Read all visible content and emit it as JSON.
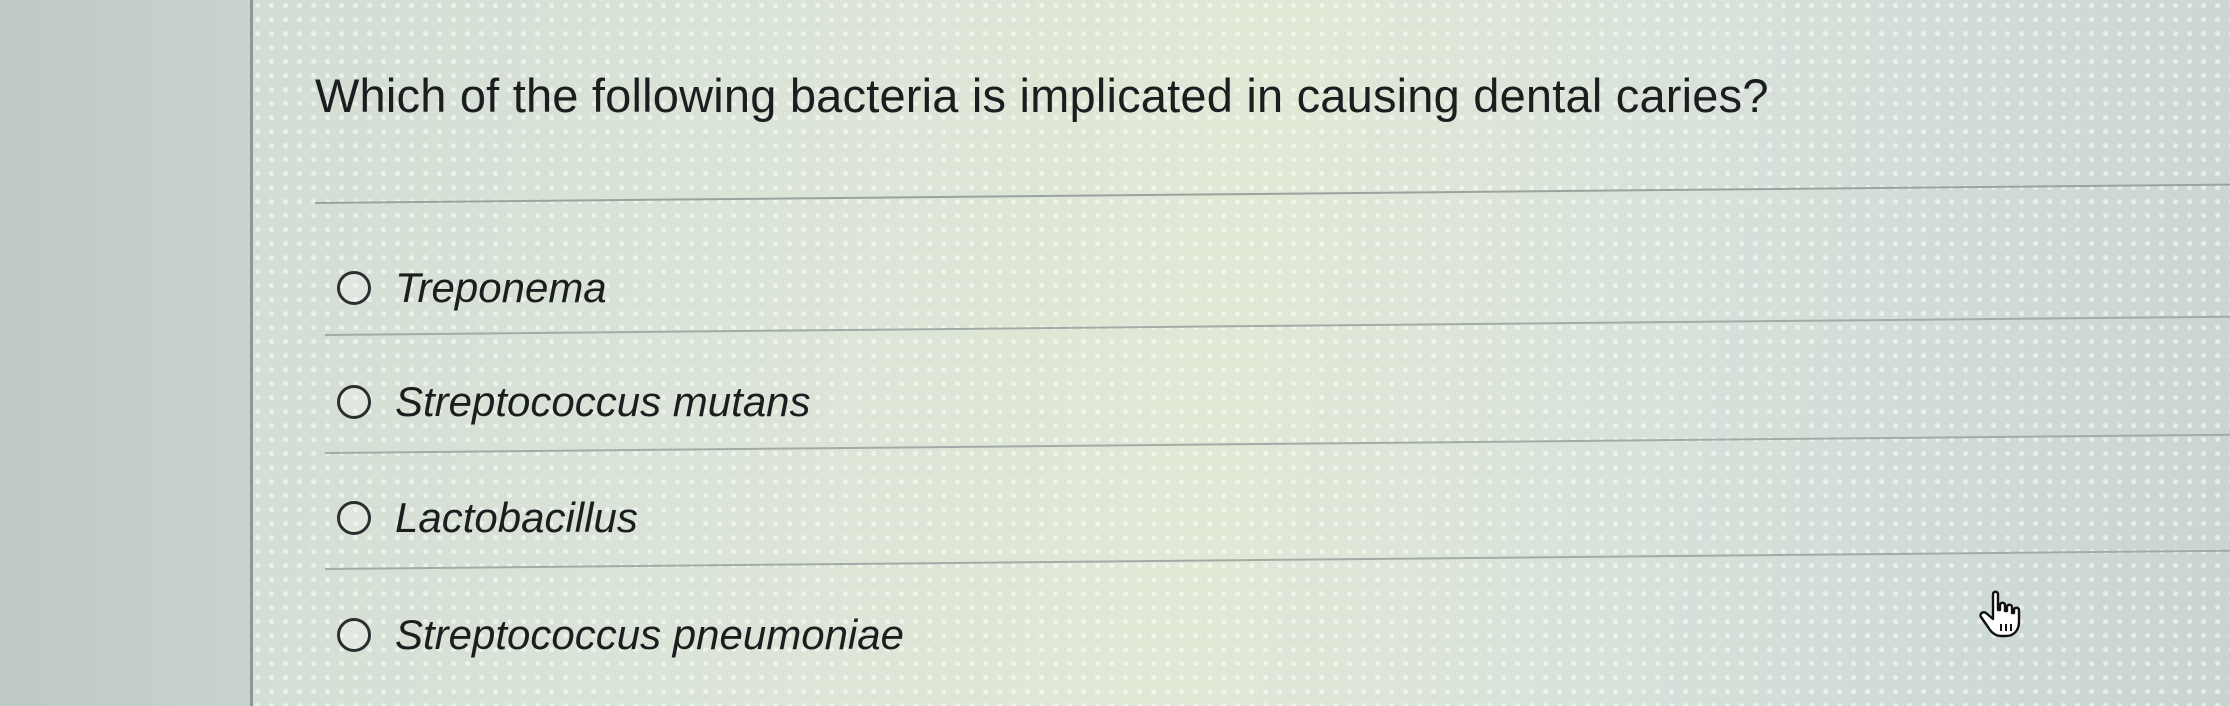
{
  "question": {
    "text": "Which of the following bacteria is implicated in causing dental caries?"
  },
  "options": [
    {
      "label": "Treponema",
      "selected": false
    },
    {
      "label": "Streptococcus mutans",
      "selected": false
    },
    {
      "label": "Lactobacillus",
      "selected": false
    },
    {
      "label": "Streptococcus pneumoniae",
      "selected": false
    }
  ],
  "colors": {
    "text": "#1b1d1e",
    "divider": "#9aa49f",
    "radio_border": "#2b2f31"
  },
  "cursor": {
    "icon": "hand-pointer-icon"
  }
}
